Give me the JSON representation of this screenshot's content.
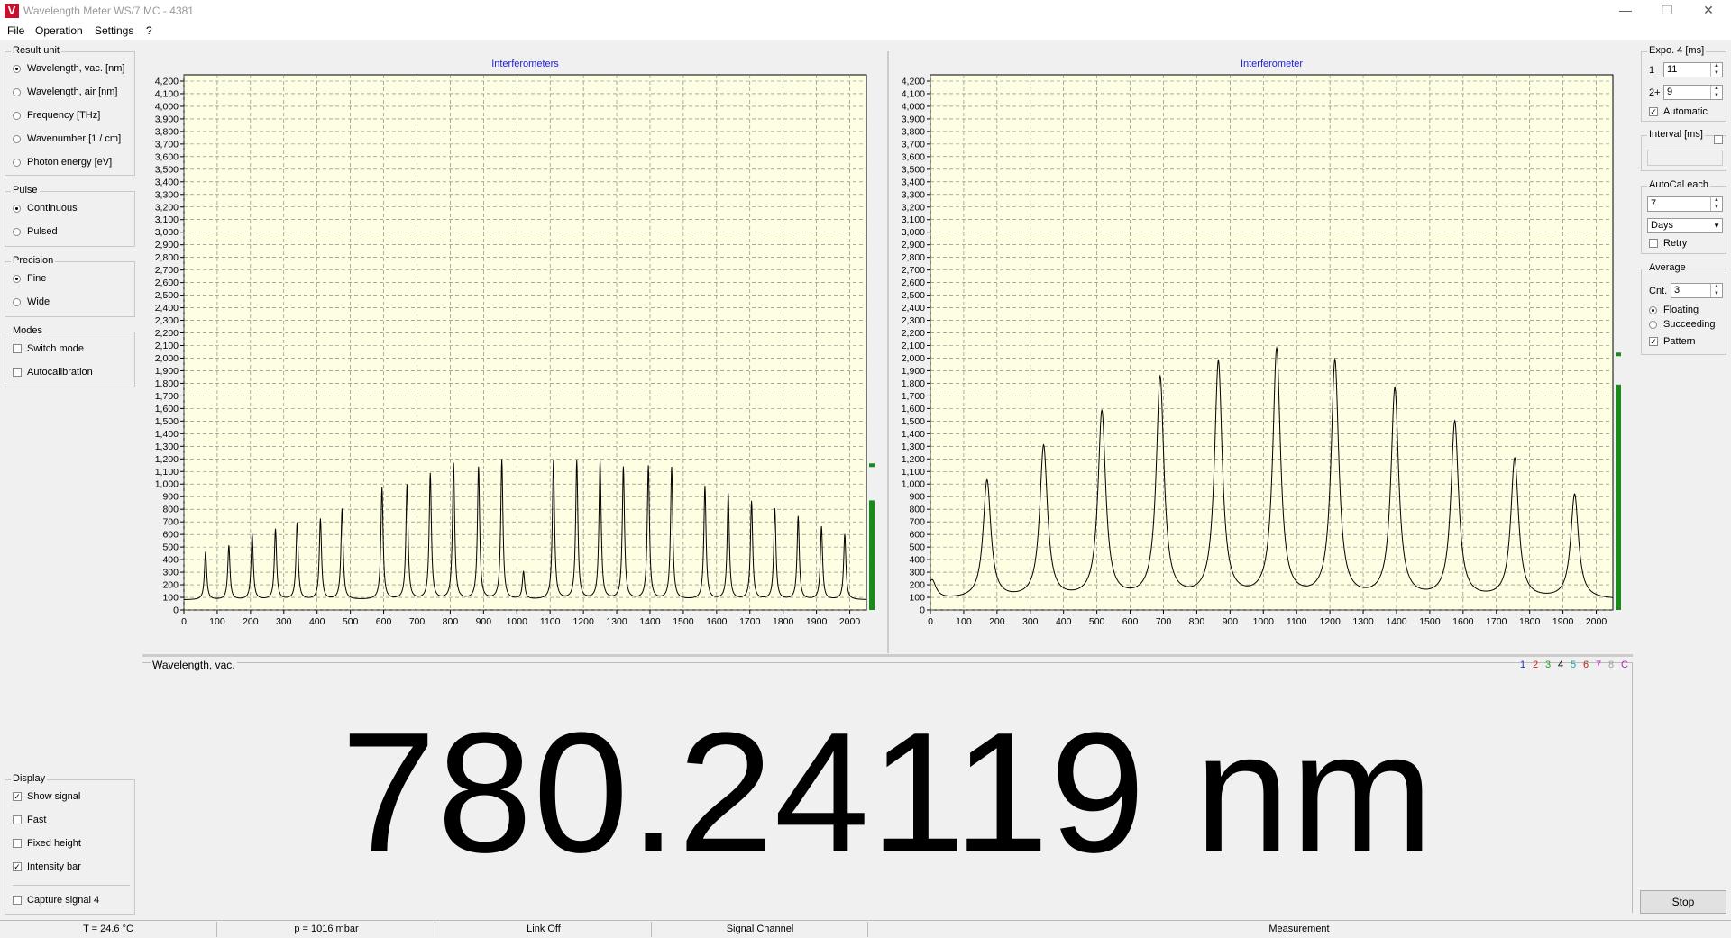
{
  "window": {
    "title": "Wavelength Meter WS/7 MC - 4381"
  },
  "menu": [
    "File",
    "Operation",
    "Settings",
    "?"
  ],
  "left_panel": {
    "result_unit": {
      "title": "Result unit",
      "options": [
        "Wavelength, vac.  [nm]",
        "Wavelength, air  [nm]",
        "Frequency  [THz]",
        "Wavenumber  [1 / cm]",
        "Photon energy  [eV]"
      ],
      "selected": 0
    },
    "pulse": {
      "title": "Pulse",
      "options": [
        "Continuous",
        "Pulsed"
      ],
      "selected": 0
    },
    "precision": {
      "title": "Precision",
      "options": [
        "Fine",
        "Wide"
      ],
      "selected": 0
    },
    "modes": {
      "title": "Modes",
      "items": [
        {
          "label": "Switch mode",
          "checked": false
        },
        {
          "label": "Autocalibration",
          "checked": false
        }
      ]
    },
    "display": {
      "title": "Display",
      "items": [
        {
          "label": "Show signal",
          "checked": true
        },
        {
          "label": "Fast",
          "checked": false
        },
        {
          "label": "Fixed height",
          "checked": false
        },
        {
          "label": "Intensity bar",
          "checked": true
        }
      ],
      "capture": {
        "label": "Capture signal 4",
        "checked": false
      }
    }
  },
  "charts": {
    "left_title": "Interferometers",
    "right_title": "Interferometer"
  },
  "chart_data": [
    {
      "type": "line",
      "title": "Interferometers",
      "xlim": [
        0,
        2050
      ],
      "ylim": [
        0,
        4250
      ],
      "x_ticks": [
        0,
        100,
        200,
        300,
        400,
        500,
        600,
        700,
        800,
        900,
        1000,
        1100,
        1200,
        1300,
        1400,
        1500,
        1600,
        1700,
        1800,
        1900,
        2000
      ],
      "y_ticks": [
        "0",
        "100",
        "200",
        "300",
        "400",
        "500",
        "600",
        "700",
        "800",
        "900",
        "1,000",
        "1,100",
        "1,200",
        "1,300",
        "1,400",
        "1,500",
        "1,600",
        "1,700",
        "1,800",
        "1,900",
        "2,000",
        "2,100",
        "2,200",
        "2,300",
        "2,400",
        "2,500",
        "2,600",
        "2,700",
        "2,800",
        "2,900",
        "3,000",
        "3,100",
        "3,200",
        "3,300",
        "3,400",
        "3,500",
        "3,600",
        "3,700",
        "3,800",
        "3,900",
        "4,000",
        "4,100",
        "4,200"
      ],
      "baseline": 80,
      "peak_width": 4,
      "peaks": [
        {
          "x": 65,
          "y": 460
        },
        {
          "x": 135,
          "y": 510
        },
        {
          "x": 205,
          "y": 600
        },
        {
          "x": 275,
          "y": 640
        },
        {
          "x": 340,
          "y": 690
        },
        {
          "x": 410,
          "y": 720
        },
        {
          "x": 475,
          "y": 800
        },
        {
          "x": 595,
          "y": 970
        },
        {
          "x": 670,
          "y": 990
        },
        {
          "x": 740,
          "y": 1080
        },
        {
          "x": 810,
          "y": 1160
        },
        {
          "x": 885,
          "y": 1130
        },
        {
          "x": 955,
          "y": 1190
        },
        {
          "x": 1020,
          "y": 300
        },
        {
          "x": 1110,
          "y": 1180
        },
        {
          "x": 1180,
          "y": 1180
        },
        {
          "x": 1250,
          "y": 1180
        },
        {
          "x": 1320,
          "y": 1130
        },
        {
          "x": 1395,
          "y": 1140
        },
        {
          "x": 1465,
          "y": 1130
        },
        {
          "x": 1565,
          "y": 980
        },
        {
          "x": 1635,
          "y": 920
        },
        {
          "x": 1705,
          "y": 860
        },
        {
          "x": 1775,
          "y": 800
        },
        {
          "x": 1845,
          "y": 740
        },
        {
          "x": 1915,
          "y": 660
        },
        {
          "x": 1985,
          "y": 600
        }
      ],
      "intensity_bar": {
        "level": 870,
        "marker": 1150
      }
    },
    {
      "type": "line",
      "title": "Interferometer",
      "xlim": [
        0,
        2050
      ],
      "ylim": [
        0,
        4250
      ],
      "x_ticks": [
        0,
        100,
        200,
        300,
        400,
        500,
        600,
        700,
        800,
        900,
        1000,
        1100,
        1200,
        1300,
        1400,
        1500,
        1600,
        1700,
        1800,
        1900,
        2000
      ],
      "y_ticks": [
        "0",
        "100",
        "200",
        "300",
        "400",
        "500",
        "600",
        "700",
        "800",
        "900",
        "1,000",
        "1,100",
        "1,200",
        "1,300",
        "1,400",
        "1,500",
        "1,600",
        "1,700",
        "1,800",
        "1,900",
        "2,000",
        "2,100",
        "2,200",
        "2,300",
        "2,400",
        "2,500",
        "2,600",
        "2,700",
        "2,800",
        "2,900",
        "3,000",
        "3,100",
        "3,200",
        "3,300",
        "3,400",
        "3,500",
        "3,600",
        "3,700",
        "3,800",
        "3,900",
        "4,000",
        "4,100",
        "4,200"
      ],
      "baseline": 80,
      "peak_width": 14,
      "peaks": [
        {
          "x": 5,
          "y": 230
        },
        {
          "x": 170,
          "y": 1020
        },
        {
          "x": 340,
          "y": 1290
        },
        {
          "x": 515,
          "y": 1560
        },
        {
          "x": 690,
          "y": 1830
        },
        {
          "x": 865,
          "y": 1950
        },
        {
          "x": 1040,
          "y": 2050
        },
        {
          "x": 1215,
          "y": 1960
        },
        {
          "x": 1395,
          "y": 1740
        },
        {
          "x": 1575,
          "y": 1480
        },
        {
          "x": 1755,
          "y": 1190
        },
        {
          "x": 1935,
          "y": 910
        }
      ],
      "intensity_bar": {
        "level": 1790,
        "marker": 2030
      }
    }
  ],
  "result": {
    "caption": "Wavelength,  vac.",
    "value": "780.24119 nm",
    "channels": [
      {
        "label": "1",
        "color": "#2030d0"
      },
      {
        "label": "2",
        "color": "#d02020"
      },
      {
        "label": "3",
        "color": "#20a020"
      },
      {
        "label": "4",
        "color": "#000000"
      },
      {
        "label": "5",
        "color": "#20a0a0"
      },
      {
        "label": "6",
        "color": "#c02020"
      },
      {
        "label": "7",
        "color": "#c020c0"
      },
      {
        "label": "8",
        "color": "#a0a0a0"
      },
      {
        "label": "C",
        "color": "#c020c0"
      }
    ]
  },
  "right_panel": {
    "expo": {
      "title": "Expo. 4  [ms]",
      "label1": "1",
      "value1": "11",
      "label2": "2+",
      "value2": "9",
      "automatic": {
        "label": "Automatic",
        "checked": true
      }
    },
    "interval": {
      "title": "Interval [ms]",
      "value": ""
    },
    "autocal": {
      "title": "AutoCal each",
      "value": "7",
      "unit": "Days",
      "retry": {
        "label": "Retry",
        "checked": false
      }
    },
    "average": {
      "title": "Average",
      "cnt_label": "Cnt.",
      "cnt_value": "3",
      "options": [
        "Floating",
        "Succeeding"
      ],
      "selected": 0,
      "pattern": {
        "label": "Pattern",
        "checked": true
      }
    },
    "stop_label": "Stop"
  },
  "status": [
    "T = 24.6 °C",
    "p = 1016 mbar",
    "Link Off",
    "Signal Channel",
    "Measurement"
  ],
  "colors": {
    "plot_bg": "#fefee3",
    "intensity": "#1a8a1a",
    "title_blue": "#1f1fd0"
  }
}
